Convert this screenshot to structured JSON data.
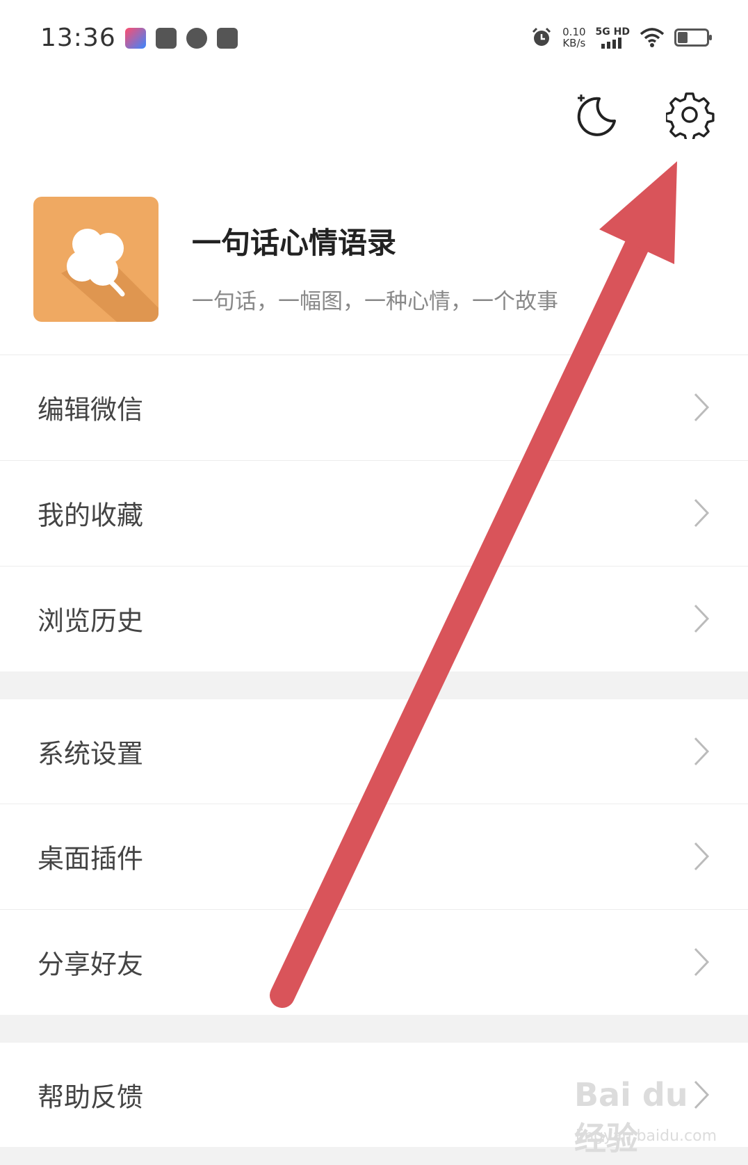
{
  "status_bar": {
    "time": "13:36",
    "net_speed_value": "0.10",
    "net_speed_unit": "KB/s",
    "signal_label": "5G HD"
  },
  "header": {
    "icons": [
      "night-mode-moon-icon",
      "settings-gear-icon"
    ]
  },
  "profile": {
    "app_name": "一句话心情语录",
    "app_desc": "一句话，一幅图，一种心情，一个故事"
  },
  "menu": {
    "group1": [
      "编辑微信",
      "我的收藏",
      "浏览历史"
    ],
    "group2": [
      "系统设置",
      "桌面插件",
      "分享好友"
    ],
    "group3": [
      "帮助反馈"
    ]
  },
  "watermark": {
    "brand": "Bai du 经验",
    "url": "jingyan.baidu.com"
  },
  "colors": {
    "accent_arrow": "#d9545a",
    "logo_bg": "#efa962",
    "section_gap": "#f2f2f2"
  }
}
